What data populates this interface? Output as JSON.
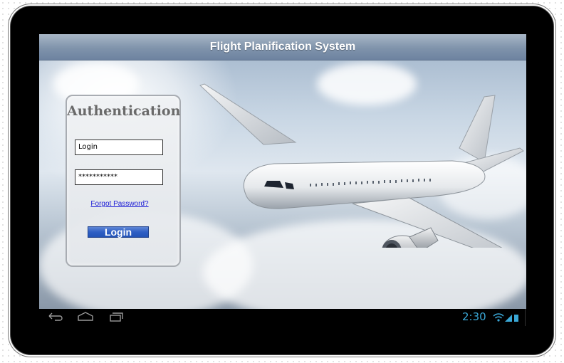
{
  "app": {
    "title": "Flight Planification System"
  },
  "auth": {
    "heading": "Authentication",
    "login_value": "Login",
    "password_value": "***********",
    "forgot_label": "Forgot Password?",
    "login_button": "Login"
  },
  "statusbar": {
    "time": "2:30"
  },
  "icons": {
    "back": "back-icon",
    "home": "home-icon",
    "recent": "recent-apps-icon",
    "wifi": "wifi-icon",
    "signal": "signal-icon",
    "battery": "battery-icon"
  },
  "colors": {
    "accent": "#3aa7d6",
    "button": "#2f5fc4",
    "link": "#1a1ad6"
  }
}
